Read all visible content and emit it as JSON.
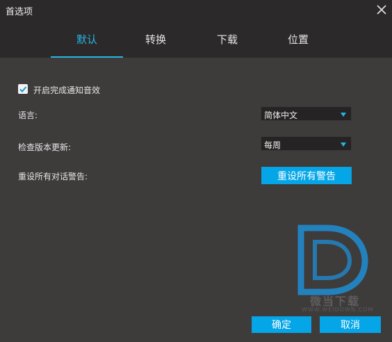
{
  "window": {
    "title": "首选项"
  },
  "tabs": [
    {
      "label": "默认",
      "active": true
    },
    {
      "label": "转换",
      "active": false
    },
    {
      "label": "下载",
      "active": false
    },
    {
      "label": "位置",
      "active": false
    }
  ],
  "settings": {
    "notify_sound": {
      "label": "开启完成通知音效",
      "checked": true
    },
    "language": {
      "label": "语言:",
      "value": "简体中文"
    },
    "update_check": {
      "label": "检查版本更新:",
      "value": "每周"
    },
    "reset_warnings": {
      "label": "重设所有对话警告:",
      "button_label": "重设所有警告"
    }
  },
  "footer": {
    "ok_label": "确定",
    "cancel_label": "取消"
  },
  "watermark": {
    "text": "微当下载",
    "url": "WWW.WEIDOWN.COM"
  },
  "colors": {
    "accent": "#27b5e6",
    "button": "#05a6e8",
    "background": "#3e3b3b",
    "header": "#2b2929"
  }
}
